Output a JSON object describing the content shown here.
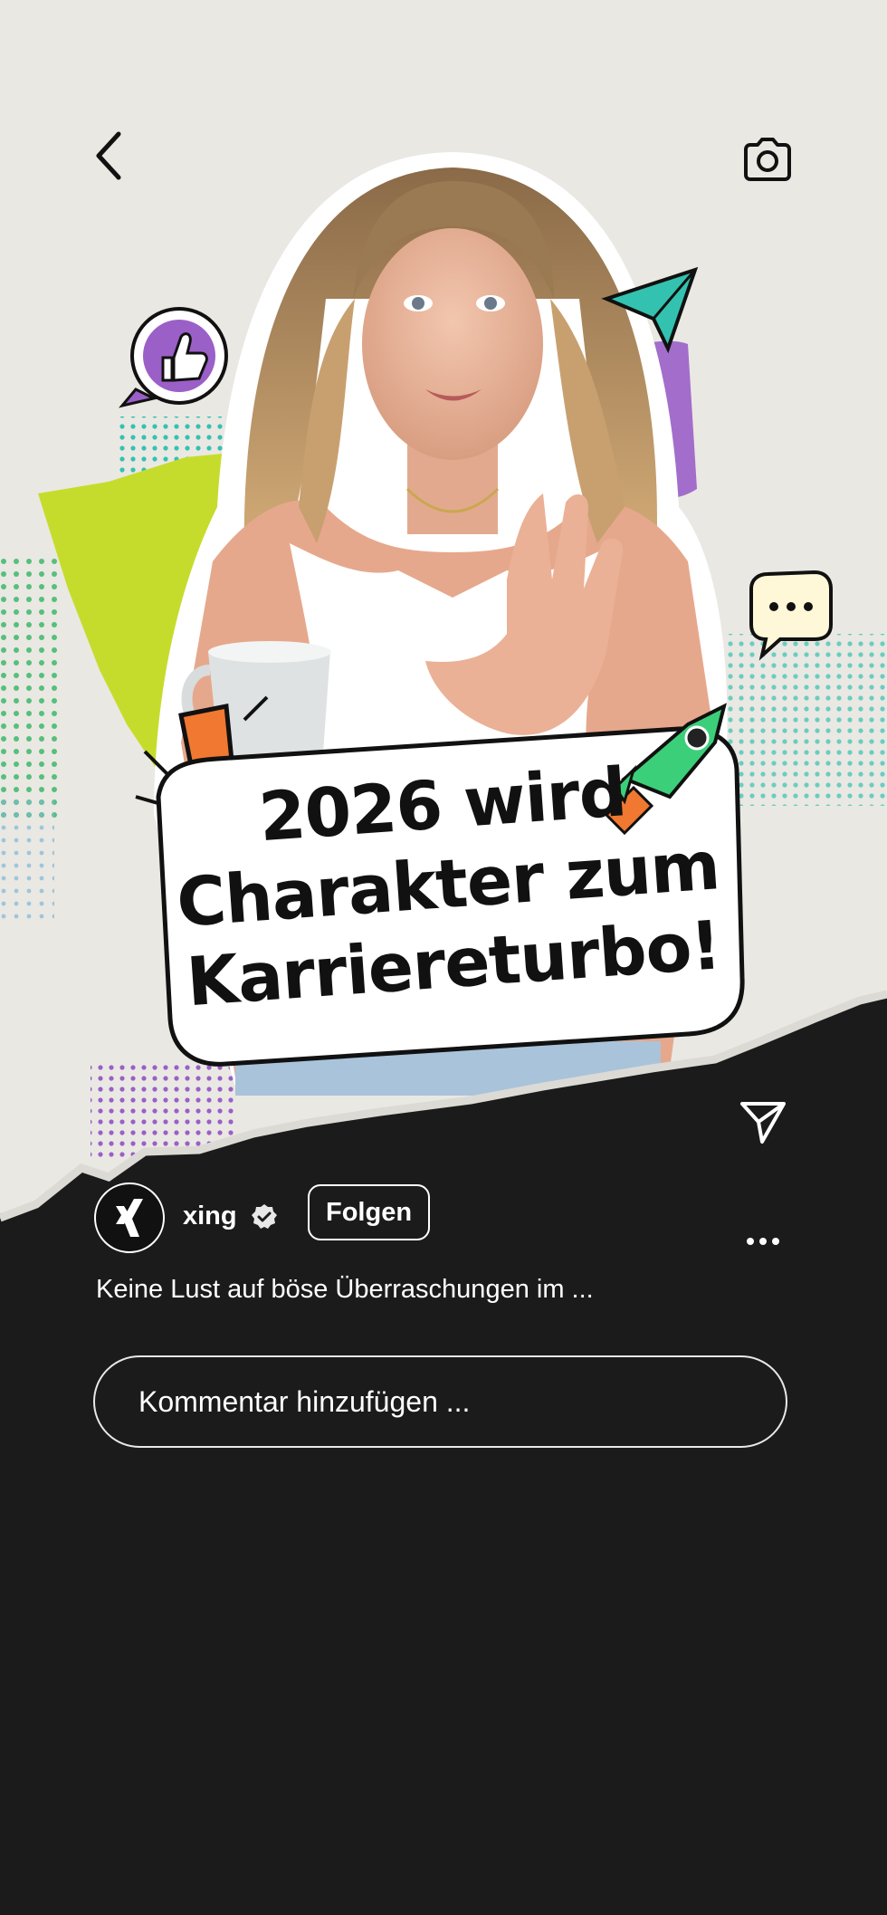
{
  "colors": {
    "background_dark": "#1a1a1a",
    "paper": "#eae8e3",
    "lime": "#c6dc2c",
    "purple": "#9b5fc8",
    "teal": "#33c2b0",
    "orange": "#f07830",
    "green": "#3ccf7a"
  },
  "icons": {
    "back": "chevron-left-icon",
    "camera": "camera-icon",
    "share": "paper-plane-icon",
    "more": "ellipsis-icon",
    "verified": "verified-badge-icon",
    "logo": "xing-logo"
  },
  "post": {
    "headline": "2026 wird Charakter zum Karriereturbo!"
  },
  "account": {
    "name": "xing",
    "follow_label": "Folgen"
  },
  "caption": "Keine Lust auf böse Überraschungen im ...",
  "comment": {
    "placeholder": "Kommentar hinzufügen ..."
  }
}
